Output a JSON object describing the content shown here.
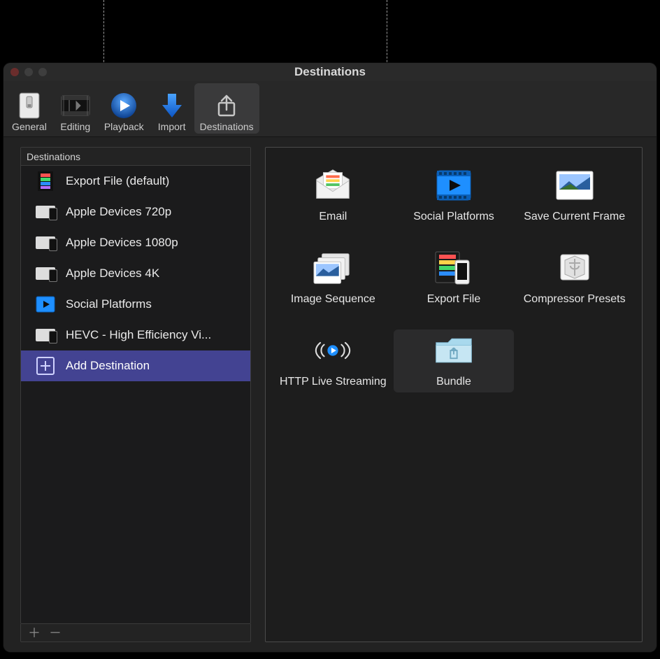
{
  "window": {
    "title": "Destinations"
  },
  "toolbar": {
    "items": [
      {
        "label": "General"
      },
      {
        "label": "Editing"
      },
      {
        "label": "Playback"
      },
      {
        "label": "Import"
      },
      {
        "label": "Destinations"
      }
    ]
  },
  "sidebar": {
    "header": "Destinations",
    "items": [
      {
        "label": "Export File (default)"
      },
      {
        "label": "Apple Devices 720p"
      },
      {
        "label": "Apple Devices 1080p"
      },
      {
        "label": "Apple Devices 4K"
      },
      {
        "label": "Social Platforms"
      },
      {
        "label": "HEVC - High Efficiency Vi..."
      },
      {
        "label": "Add Destination"
      }
    ]
  },
  "tiles": [
    {
      "label": "Email"
    },
    {
      "label": "Social Platforms"
    },
    {
      "label": "Save Current Frame"
    },
    {
      "label": "Image Sequence"
    },
    {
      "label": "Export File"
    },
    {
      "label": "Compressor Presets"
    },
    {
      "label": "HTTP Live Streaming"
    },
    {
      "label": "Bundle"
    }
  ]
}
